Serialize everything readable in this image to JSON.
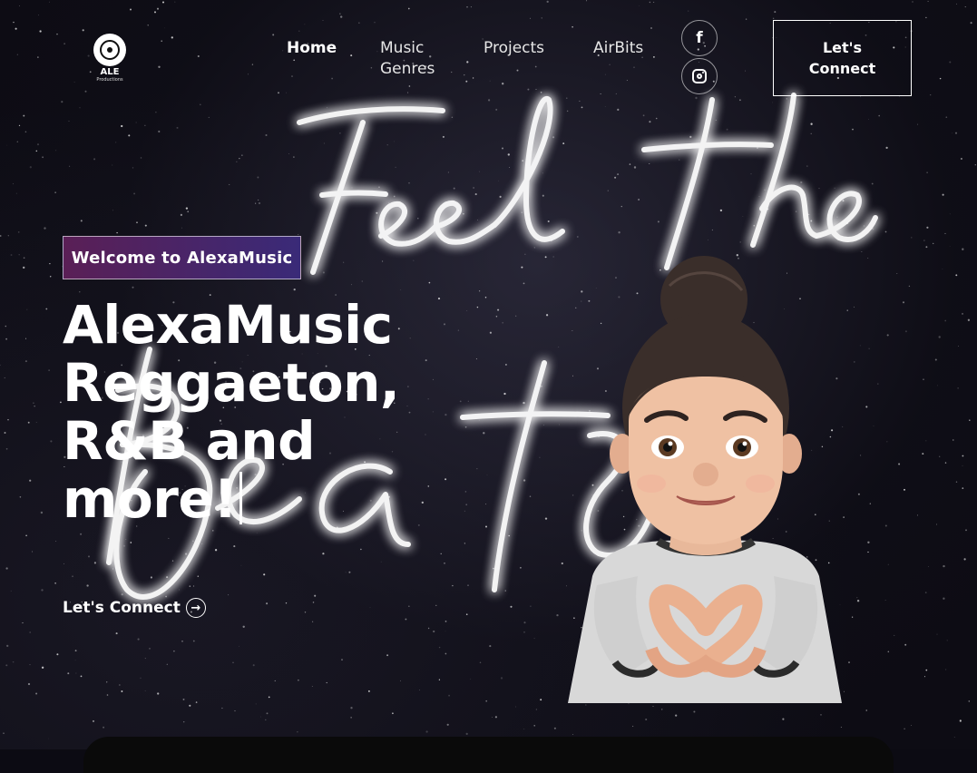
{
  "logo": {
    "title": "ALE",
    "subtitle": "Productions"
  },
  "nav": {
    "items": [
      {
        "label": "Home",
        "active": true
      },
      {
        "label": "Music Genres"
      },
      {
        "label": "Projects"
      },
      {
        "label": "AirBits"
      }
    ],
    "social": [
      {
        "icon": "facebook-icon",
        "glyph": "f"
      },
      {
        "icon": "instagram-icon"
      }
    ],
    "connect_label": "Let's Connect"
  },
  "hero": {
    "neon_text": [
      "Feel the",
      "Beats"
    ],
    "badge": "Welcome to AlexaMusic",
    "headline": "AlexaMusic Reggaeton, R&B and more!",
    "cta_label": "Let's Connect",
    "cta_icon": "arrow-right-circle-icon"
  },
  "colors": {
    "background": "#0d0c14",
    "badge_gradient_start": "#5a1f56",
    "badge_gradient_end": "#3a2a78",
    "text": "#ffffff"
  }
}
